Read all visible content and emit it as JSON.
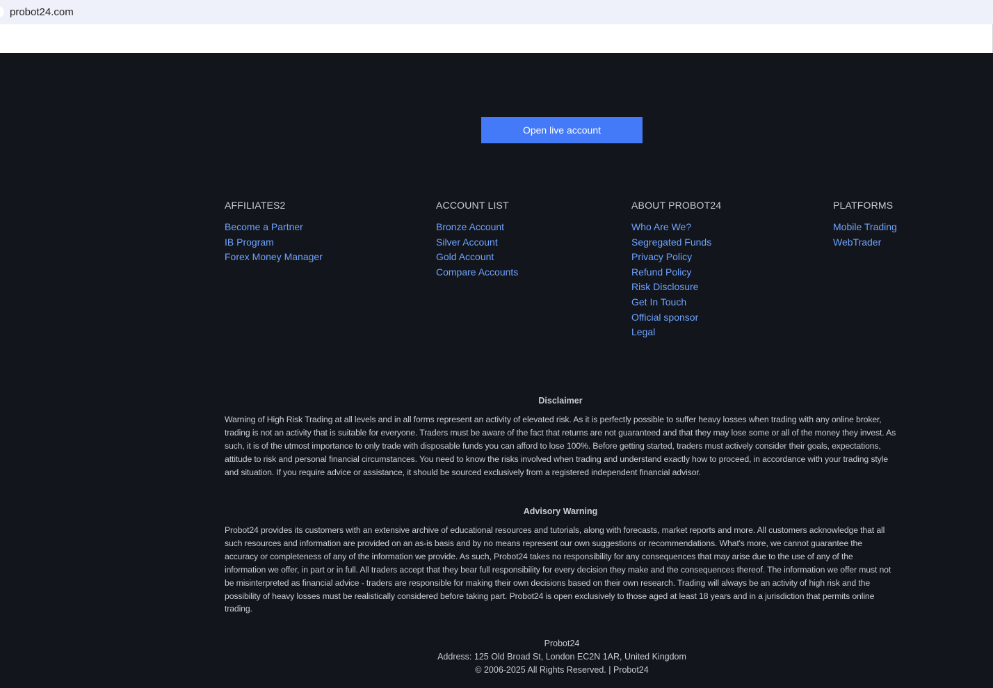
{
  "browser": {
    "url": "probot24.com"
  },
  "cta": {
    "label": "Open live account"
  },
  "columns": {
    "affiliates": {
      "title": "AFFILIATES2",
      "links": [
        "Become a Partner",
        "IB Program",
        "Forex Money Manager"
      ]
    },
    "accounts": {
      "title": "ACCOUNT LIST",
      "links": [
        "Bronze Account",
        "Silver Account",
        "Gold Account",
        "Compare Accounts"
      ]
    },
    "about": {
      "title": "ABOUT PROBOT24",
      "links": [
        "Who Are We?",
        "Segregated Funds",
        "Privacy Policy",
        "Refund Policy",
        "Risk Disclosure",
        "Get In Touch",
        "Official sponsor",
        "Legal"
      ]
    },
    "platforms": {
      "title": "PLATFORMS",
      "links": [
        "Mobile Trading",
        "WebTrader"
      ]
    }
  },
  "disclaimer": {
    "title": "Disclaimer",
    "text": "Warning of High Risk Trading at all levels and in all forms represent an activity of elevated risk. As it is perfectly possible to suffer heavy losses when trading with any online broker, trading is not an activity that is suitable for everyone. Traders must be aware of the fact that returns are not guaranteed and that they may lose some or all of the money they invest. As such, it is of the utmost importance to only trade with disposable funds you can afford to lose 100%. Before getting started, traders must actively consider their goals, expectations, attitude to risk and personal financial circumstances. You need to know the risks involved when trading and understand exactly how to proceed, in accordance with your trading style and situation. If you require advice or assistance, it should be sourced exclusively from a registered independent financial advisor."
  },
  "advisory": {
    "title": "Advisory Warning",
    "text": "Probot24 provides its customers with an extensive archive of educational resources and tutorials, along with forecasts, market reports and more. All customers acknowledge that all such resources and information are provided on an as-is basis and by no means represent our own suggestions or recommendations. What's more, we cannot guarantee the accuracy or completeness of any of the information we provide. As such, Probot24 takes no responsibility for any consequences that may arise due to the use of any of the information we offer, in part or in full. All traders accept that they bear full responsibility for every decision they make and the consequences thereof. The information we offer must not be misinterpreted as financial advice - traders are responsible for making their own decisions based on their own research. Trading will always be an activity of high risk and the possibility of heavy losses must be realistically considered before taking part. Probot24 is open exclusively to those aged at least 18 years and in a jurisdiction that permits online trading."
  },
  "company": {
    "name": "Probot24",
    "address": "Address: 125 Old Broad St, London EC2N 1AR, United Kingdom",
    "copyright": "© 2006-2025 All Rights Reserved. | Probot24"
  },
  "colors": {
    "footer_bg": "#12151b",
    "accent": "#4479f7",
    "link": "#6fa3ff"
  }
}
